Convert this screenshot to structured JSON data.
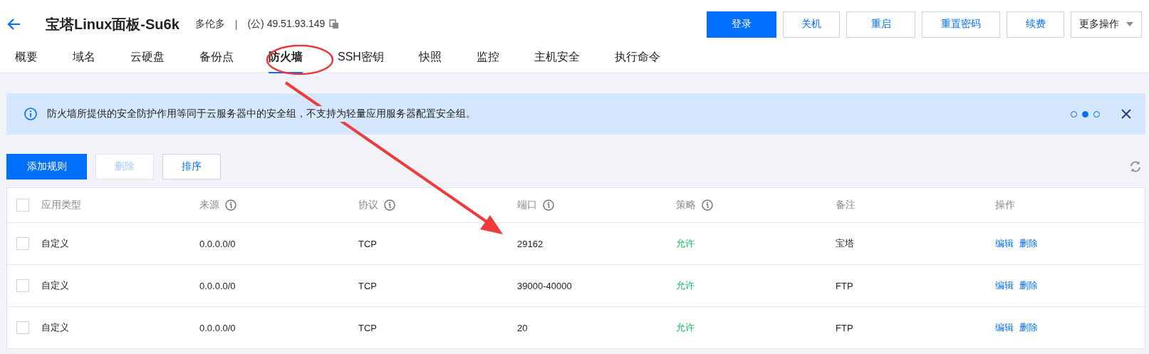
{
  "header": {
    "title": "宝塔Linux面板-Su6k",
    "region": "多伦多",
    "separator": "|",
    "ip": "(公) 49.51.93.149"
  },
  "actions": [
    {
      "label": "登录",
      "kind": "primary"
    },
    {
      "label": "关机",
      "kind": "link"
    },
    {
      "label": "重启",
      "kind": "link"
    },
    {
      "label": "重置密码",
      "kind": "link"
    },
    {
      "label": "续费",
      "kind": "link"
    },
    {
      "label": "更多操作",
      "kind": "dropdown"
    }
  ],
  "tabs": [
    {
      "label": "概要",
      "selected": false
    },
    {
      "label": "域名",
      "selected": false
    },
    {
      "label": "云硬盘",
      "selected": false
    },
    {
      "label": "备份点",
      "selected": false
    },
    {
      "label": "防火墙",
      "selected": true
    },
    {
      "label": "SSH密钥",
      "selected": false
    },
    {
      "label": "快照",
      "selected": false
    },
    {
      "label": "监控",
      "selected": false
    },
    {
      "label": "主机安全",
      "selected": false
    },
    {
      "label": "执行命令",
      "selected": false
    }
  ],
  "notice": {
    "text": "防火墙所提供的安全防护作用等同于云服务器中的安全组，不支持为轻量应用服务器配置安全组。",
    "pager": [
      {
        "selected": false
      },
      {
        "selected": true
      },
      {
        "selected": false
      }
    ]
  },
  "toolbar": [
    {
      "label": "添加规则",
      "kind": "primary",
      "disabled": false
    },
    {
      "label": "删除",
      "kind": "default",
      "disabled": true
    },
    {
      "label": "排序",
      "kind": "default",
      "disabled": false
    }
  ],
  "table": {
    "select_all_checked": false,
    "columns": [
      {
        "label": "应用类型",
        "info": false
      },
      {
        "label": "来源",
        "info": true
      },
      {
        "label": "协议",
        "info": true
      },
      {
        "label": "端口",
        "info": true
      },
      {
        "label": "策略",
        "info": true
      },
      {
        "label": "备注",
        "info": false
      },
      {
        "label": "操作",
        "info": false
      }
    ],
    "rows": [
      {
        "checked": false,
        "type": "自定义",
        "source": "0.0.0.0/0",
        "protocol": "TCP",
        "port": "29162",
        "policy": "允许",
        "note": "宝塔",
        "actions": [
          "编辑",
          "删除"
        ]
      },
      {
        "checked": false,
        "type": "自定义",
        "source": "0.0.0.0/0",
        "protocol": "TCP",
        "port": "39000-40000",
        "policy": "允许",
        "note": "FTP",
        "actions": [
          "编辑",
          "删除"
        ]
      },
      {
        "checked": false,
        "type": "自定义",
        "source": "0.0.0.0/0",
        "protocol": "TCP",
        "port": "20",
        "policy": "允许",
        "note": "FTP",
        "actions": [
          "编辑",
          "删除"
        ]
      }
    ]
  }
}
